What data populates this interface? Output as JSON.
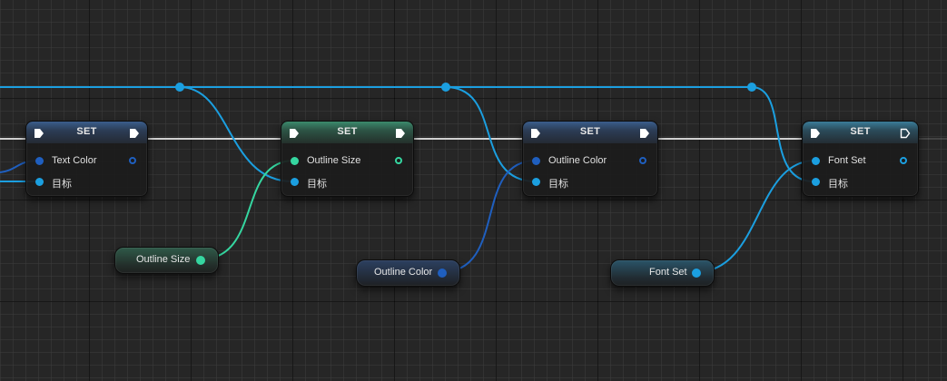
{
  "colors": {
    "exec_wire": "#cfcfcf",
    "object_wire": "#1b9fe0",
    "float_wire": "#35d6a0",
    "color_wire": "#1f5fbf"
  },
  "nodes": [
    {
      "title": "SET",
      "header_color": "blue",
      "pins": [
        "Text Color",
        "目标"
      ]
    },
    {
      "title": "SET",
      "header_color": "green",
      "pins": [
        "Outline Size",
        "目标"
      ]
    },
    {
      "title": "SET",
      "header_color": "blue",
      "pins": [
        "Outline Color",
        "目标"
      ]
    },
    {
      "title": "SET",
      "header_color": "cyan",
      "pins": [
        "Font Set",
        "目标"
      ]
    }
  ],
  "variables": [
    {
      "label": "Outline Size",
      "type": "float"
    },
    {
      "label": "Outline Color",
      "type": "color"
    },
    {
      "label": "Font Set",
      "type": "object"
    }
  ]
}
